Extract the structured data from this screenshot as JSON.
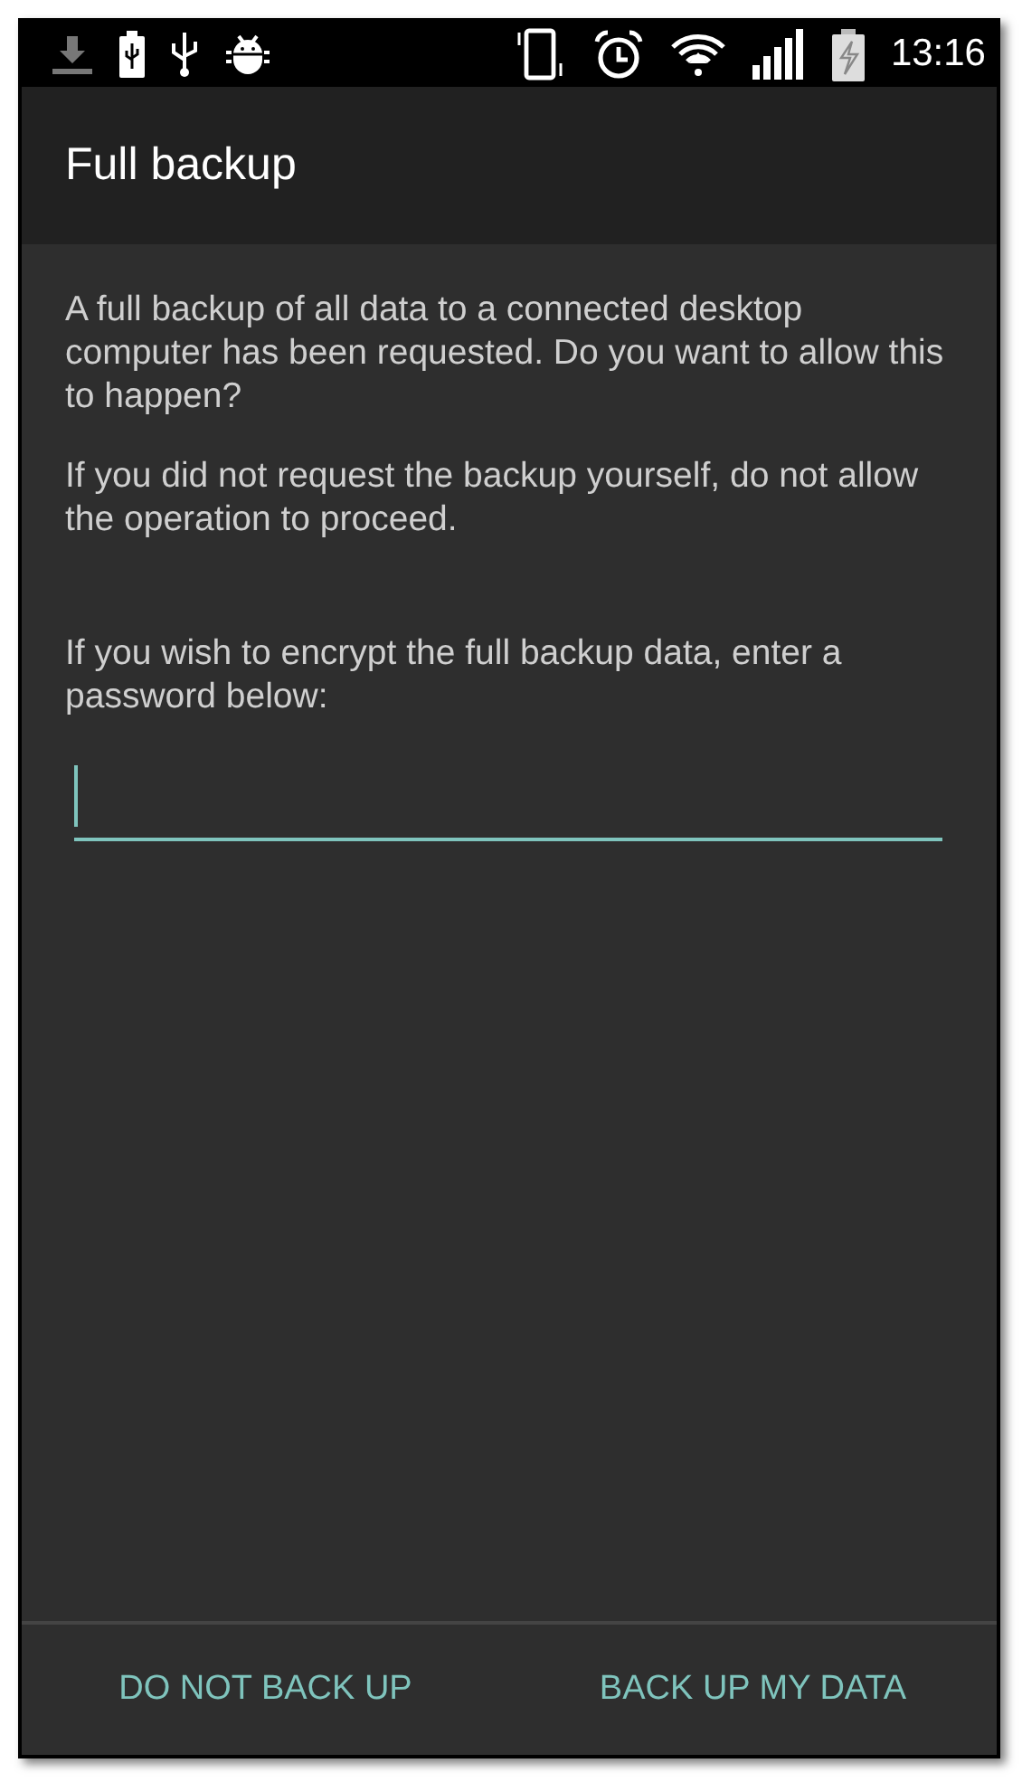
{
  "status_bar": {
    "time": "13:16"
  },
  "app_bar": {
    "title": "Full backup"
  },
  "paragraphs": [
    "A full backup of all data to a connected desktop computer has been requested.  Do you want to allow this to happen?",
    "If you did not request the backup yourself, do not allow the operation to proceed.",
    "If you wish to encrypt the full backup data, enter a password below:"
  ],
  "password_field": {
    "focused": true
  },
  "buttons": [
    {
      "label": "DO NOT BACK UP"
    },
    {
      "label": "BACK UP MY DATA"
    }
  ]
}
